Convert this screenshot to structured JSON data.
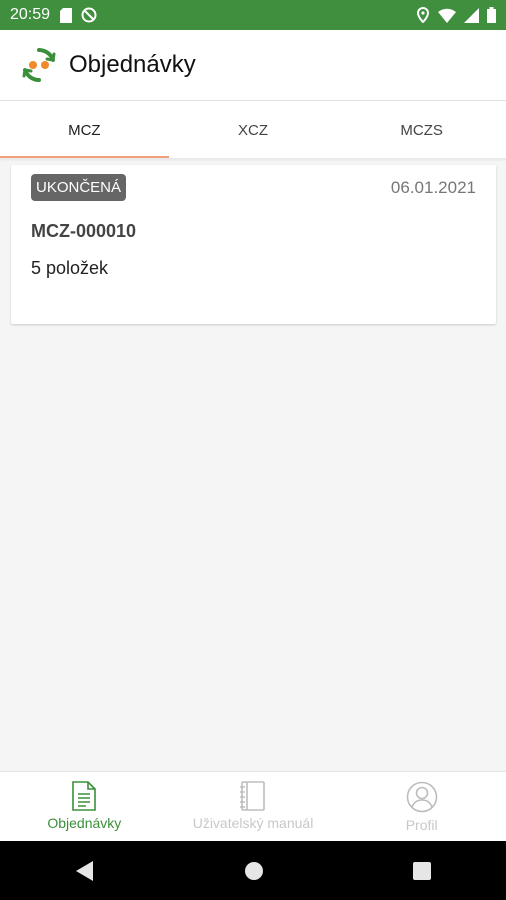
{
  "status_bar": {
    "time": "20:59",
    "background": "#3f8f3f"
  },
  "app_bar": {
    "title": "Objednávky"
  },
  "tabs": [
    {
      "label": "MCZ",
      "active": true
    },
    {
      "label": "XCZ",
      "active": false
    },
    {
      "label": "MCZS",
      "active": false
    }
  ],
  "orders": [
    {
      "status": "UKONČENÁ",
      "date": "06.01.2021",
      "number": "MCZ-000010",
      "items": "5 položek"
    }
  ],
  "bottom_nav": [
    {
      "label": "Objednávky",
      "icon": "document-icon",
      "active": true
    },
    {
      "label": "Uživatelský manuál",
      "icon": "manual-icon",
      "active": false
    },
    {
      "label": "Profil",
      "icon": "profile-icon",
      "active": false
    }
  ],
  "colors": {
    "brand_green": "#3a8f3a",
    "tab_indicator": "#f0a07a",
    "badge_bg": "#666666"
  }
}
